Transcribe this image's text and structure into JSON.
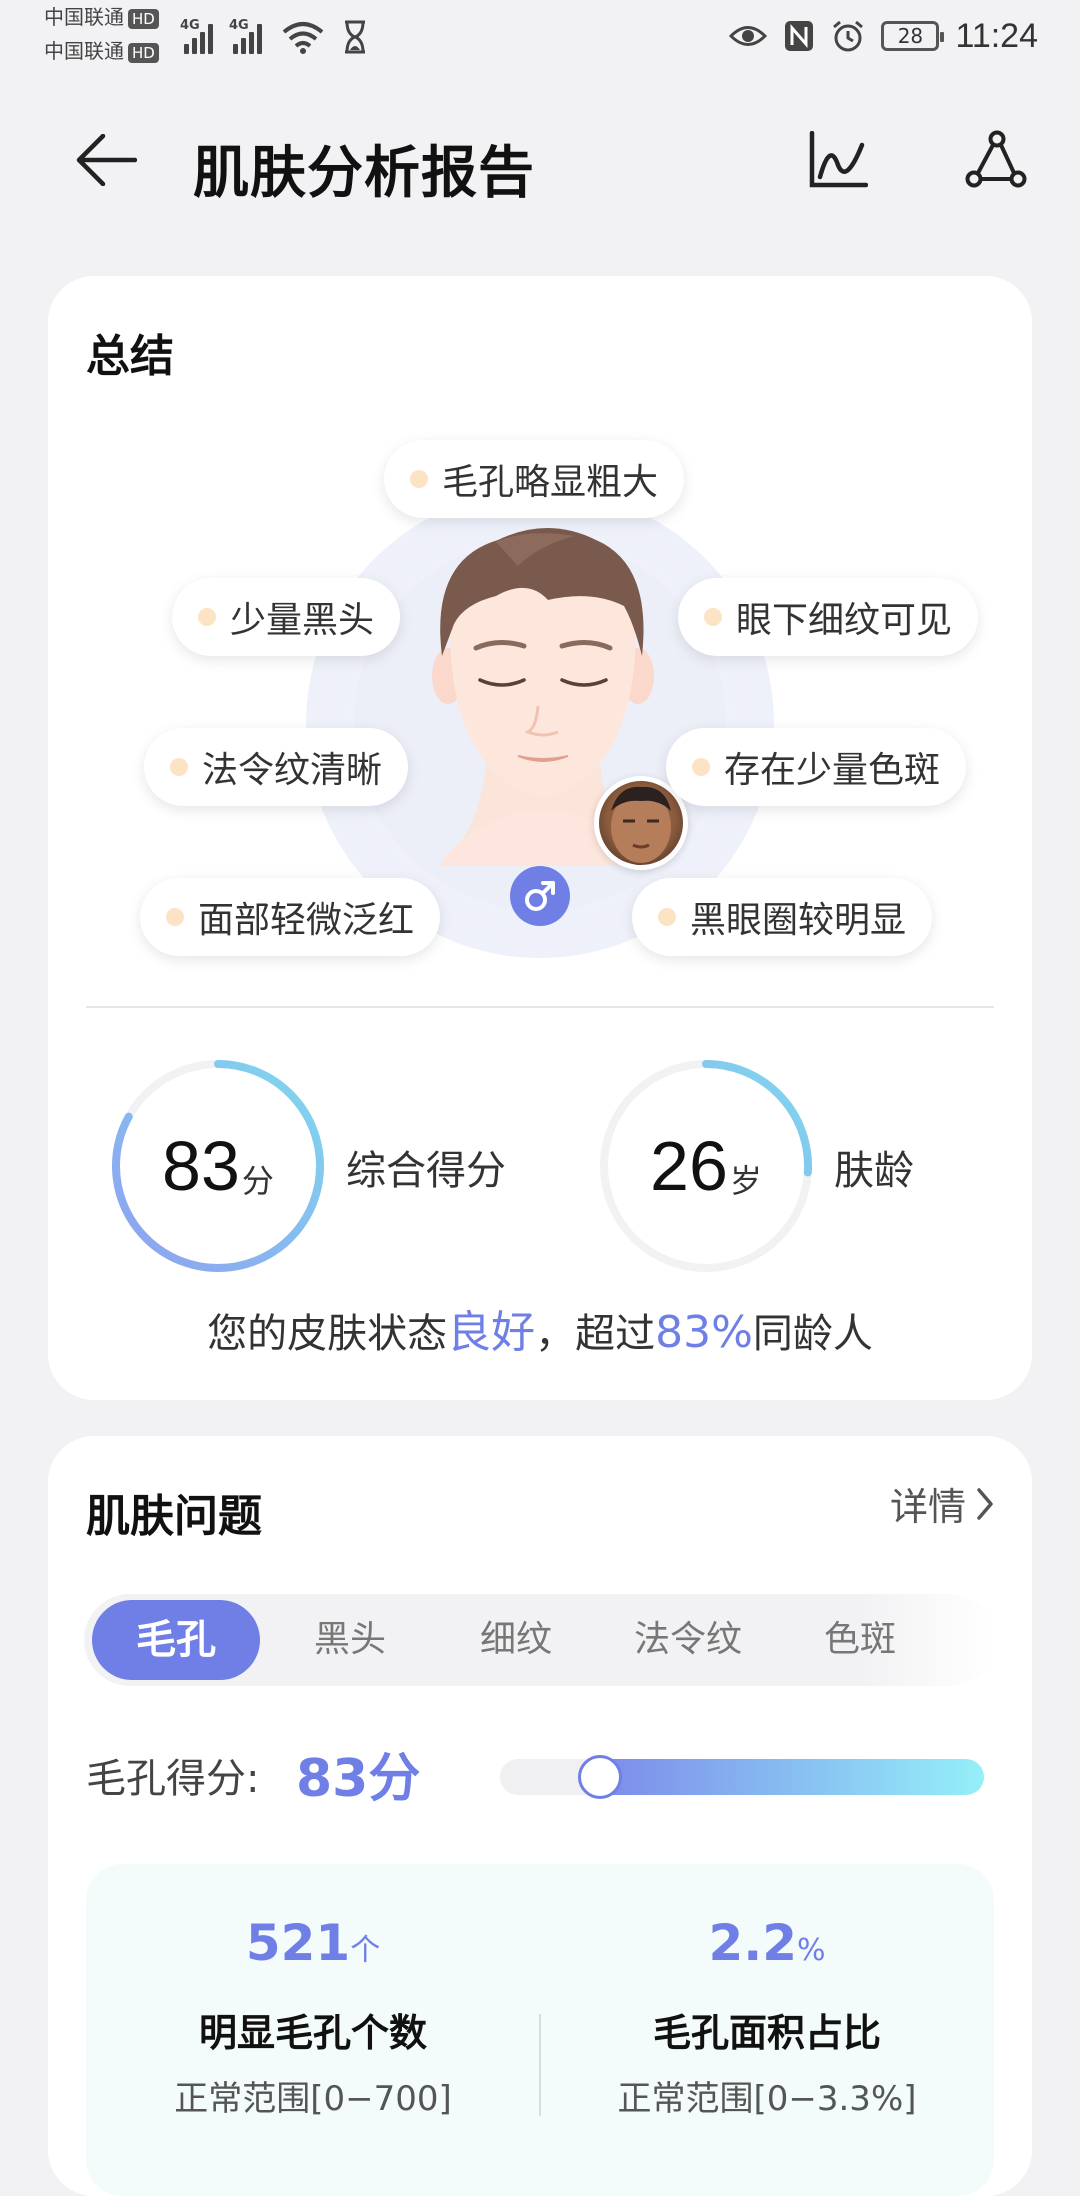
{
  "status_bar": {
    "carrier_1": "中国联通",
    "carrier_2": "中国联通",
    "hd_badge": "HD",
    "signal_1_gen": "4G",
    "signal_2_gen": "4G",
    "battery": "28",
    "time": "11:24"
  },
  "header": {
    "title": "肌肤分析报告"
  },
  "summary": {
    "title": "总结",
    "tags": [
      "毛孔略显粗大",
      "少量黑头",
      "眼下细纹可见",
      "法令纹清晰",
      "存在少量色斑",
      "面部轻微泛红",
      "黑眼圈较明显"
    ],
    "score": {
      "value": "83",
      "unit": "分",
      "label": "综合得分",
      "progress": 0.83
    },
    "skin_age": {
      "value": "26",
      "unit": "岁",
      "label": "肤龄",
      "progress": 0.26
    },
    "line": {
      "prefix": "您的皮肤状态",
      "status": "良好",
      "middle": "，超过",
      "percent": "83%",
      "suffix": "同龄人"
    }
  },
  "issues": {
    "title": "肌肤问题",
    "detail_label": "详情",
    "tabs": [
      "毛孔",
      "黑头",
      "细纹",
      "法令纹",
      "色斑"
    ],
    "active_tab": "毛孔",
    "score_label": "毛孔得分:",
    "score_value": "83分",
    "score_progress": 0.83,
    "stats": [
      {
        "value": "521",
        "unit": "个",
        "title": "明显毛孔个数",
        "range": "正常范围[0−700]"
      },
      {
        "value": "2.2",
        "unit": "%",
        "title": "毛孔面积占比",
        "range": "正常范围[0−3.3%]"
      }
    ]
  },
  "colors": {
    "accent": "#6f7fe6",
    "ring_cyan": "#7fd8ee",
    "tag_dot": "#fbe3c4"
  }
}
